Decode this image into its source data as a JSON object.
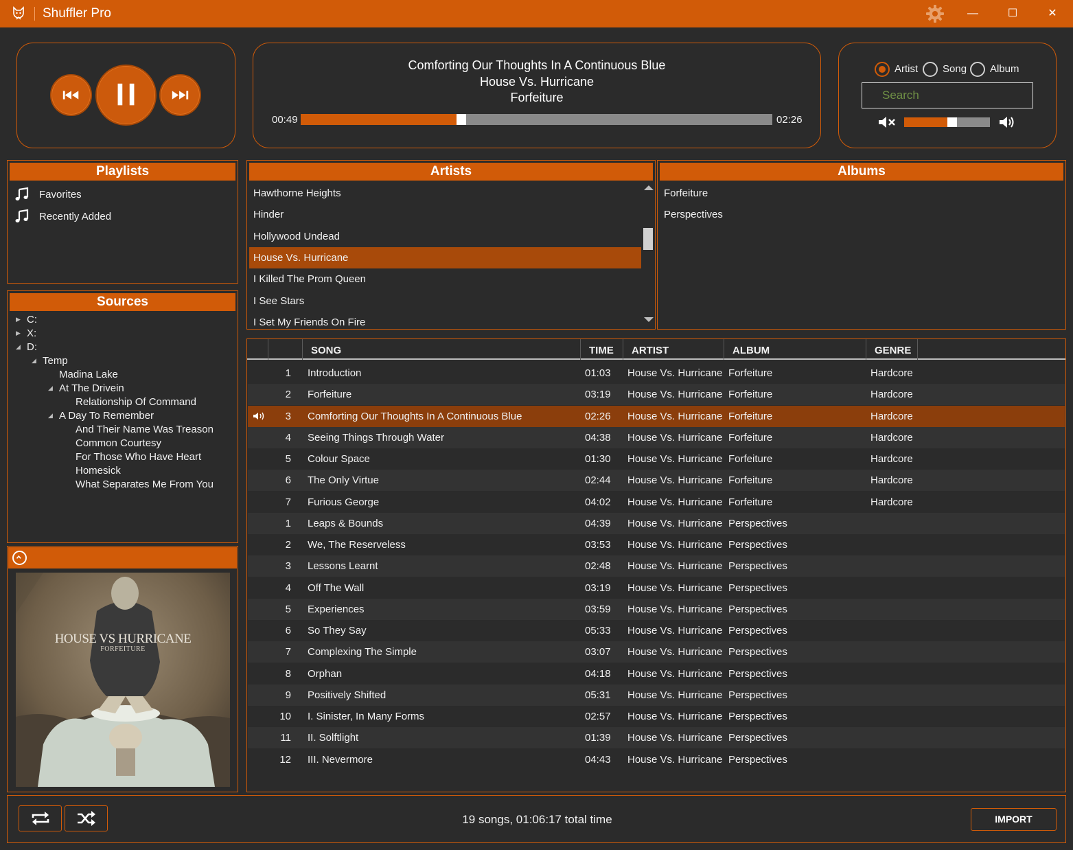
{
  "window": {
    "title": "Shuffler Pro",
    "minimize_label": "—",
    "maximize_label": "☐",
    "close_label": "✕"
  },
  "colors": {
    "accent": "#d15b08",
    "background": "#2b2b2b",
    "row_alt": "#333333",
    "selected": "#a84a0a",
    "playing_row": "#8b3e0c",
    "track": "#8a8a8a"
  },
  "now_playing": {
    "title": "Comforting Our Thoughts In A Continuous Blue",
    "artist": "House Vs. Hurricane",
    "album": "Forfeiture",
    "elapsed": "00:49",
    "total": "02:26",
    "progress": 0.34
  },
  "transport": {
    "prev_icon": "skip-previous-icon",
    "pause_icon": "pause-icon",
    "next_icon": "skip-next-icon"
  },
  "search": {
    "filters": [
      "Artist",
      "Song",
      "Album"
    ],
    "selected_filter": "Artist",
    "placeholder": "Search",
    "volume": 0.56
  },
  "playlists": {
    "header": "Playlists",
    "items": [
      "Favorites",
      "Recently Added"
    ]
  },
  "sources": {
    "header": "Sources",
    "tree": [
      {
        "label": "C:",
        "depth": 0,
        "expander": "collapsed"
      },
      {
        "label": "X:",
        "depth": 0,
        "expander": "collapsed"
      },
      {
        "label": "D:",
        "depth": 0,
        "expander": "expanded"
      },
      {
        "label": "Temp",
        "depth": 1,
        "expander": "expanded"
      },
      {
        "label": "Madina Lake",
        "depth": 2,
        "expander": "none"
      },
      {
        "label": "At The Drivein",
        "depth": 2,
        "expander": "expanded"
      },
      {
        "label": "Relationship Of Command",
        "depth": 3,
        "expander": "none"
      },
      {
        "label": "A Day To Remember",
        "depth": 2,
        "expander": "expanded"
      },
      {
        "label": "And Their Name Was Treason",
        "depth": 3,
        "expander": "none"
      },
      {
        "label": "Common Courtesy",
        "depth": 3,
        "expander": "none"
      },
      {
        "label": "For Those Who Have Heart",
        "depth": 3,
        "expander": "none"
      },
      {
        "label": "Homesick",
        "depth": 3,
        "expander": "none"
      },
      {
        "label": "What Separates Me From You",
        "depth": 3,
        "expander": "none"
      }
    ]
  },
  "album_art": {
    "band": "HOUSE VS HURRICANE",
    "album": "FORFEITURE"
  },
  "artists": {
    "header": "Artists",
    "items": [
      "Hawthorne Heights",
      "Hinder",
      "Hollywood Undead",
      "House Vs. Hurricane",
      "I Killed The Prom Queen",
      "I See Stars",
      "I Set My Friends On Fire"
    ],
    "selected": "House Vs. Hurricane"
  },
  "albums": {
    "header": "Albums",
    "items": [
      "Forfeiture",
      "Perspectives"
    ]
  },
  "songs": {
    "columns": [
      "SONG",
      "TIME",
      "ARTIST",
      "ALBUM",
      "GENRE"
    ],
    "playing_index": 2,
    "rows": [
      {
        "num": "1",
        "song": "Introduction",
        "time": "01:03",
        "artist": "House Vs. Hurricane",
        "album": "Forfeiture",
        "genre": "Hardcore"
      },
      {
        "num": "2",
        "song": "Forfeiture",
        "time": "03:19",
        "artist": "House Vs. Hurricane",
        "album": "Forfeiture",
        "genre": "Hardcore"
      },
      {
        "num": "3",
        "song": "Comforting Our Thoughts In A Continuous Blue",
        "time": "02:26",
        "artist": "House Vs. Hurricane",
        "album": "Forfeiture",
        "genre": "Hardcore"
      },
      {
        "num": "4",
        "song": "Seeing Things Through Water",
        "time": "04:38",
        "artist": "House Vs. Hurricane",
        "album": "Forfeiture",
        "genre": "Hardcore"
      },
      {
        "num": "5",
        "song": "Colour Space",
        "time": "01:30",
        "artist": "House Vs. Hurricane",
        "album": "Forfeiture",
        "genre": "Hardcore"
      },
      {
        "num": "6",
        "song": "The Only Virtue",
        "time": "02:44",
        "artist": "House Vs. Hurricane",
        "album": "Forfeiture",
        "genre": "Hardcore"
      },
      {
        "num": "7",
        "song": "Furious George",
        "time": "04:02",
        "artist": "House Vs. Hurricane",
        "album": "Forfeiture",
        "genre": "Hardcore"
      },
      {
        "num": "1",
        "song": "Leaps & Bounds",
        "time": "04:39",
        "artist": "House Vs. Hurricane",
        "album": "Perspectives",
        "genre": ""
      },
      {
        "num": "2",
        "song": "We, The Reserveless",
        "time": "03:53",
        "artist": "House Vs. Hurricane",
        "album": "Perspectives",
        "genre": ""
      },
      {
        "num": "3",
        "song": "Lessons Learnt",
        "time": "02:48",
        "artist": "House Vs. Hurricane",
        "album": "Perspectives",
        "genre": ""
      },
      {
        "num": "4",
        "song": "Off The Wall",
        "time": "03:19",
        "artist": "House Vs. Hurricane",
        "album": "Perspectives",
        "genre": ""
      },
      {
        "num": "5",
        "song": "Experiences",
        "time": "03:59",
        "artist": "House Vs. Hurricane",
        "album": "Perspectives",
        "genre": ""
      },
      {
        "num": "6",
        "song": "So They Say",
        "time": "05:33",
        "artist": "House Vs. Hurricane",
        "album": "Perspectives",
        "genre": ""
      },
      {
        "num": "7",
        "song": "Complexing The Simple",
        "time": "03:07",
        "artist": "House Vs. Hurricane",
        "album": "Perspectives",
        "genre": ""
      },
      {
        "num": "8",
        "song": "Orphan",
        "time": "04:18",
        "artist": "House Vs. Hurricane",
        "album": "Perspectives",
        "genre": ""
      },
      {
        "num": "9",
        "song": "Positively Shifted",
        "time": "05:31",
        "artist": "House Vs. Hurricane",
        "album": "Perspectives",
        "genre": ""
      },
      {
        "num": "10",
        "song": "I. Sinister, In Many Forms",
        "time": "02:57",
        "artist": "House Vs. Hurricane",
        "album": "Perspectives",
        "genre": ""
      },
      {
        "num": "11",
        "song": "II. Solftlight",
        "time": "01:39",
        "artist": "House Vs. Hurricane",
        "album": "Perspectives",
        "genre": ""
      },
      {
        "num": "12",
        "song": "III. Nevermore",
        "time": "04:43",
        "artist": "House Vs. Hurricane",
        "album": "Perspectives",
        "genre": ""
      }
    ]
  },
  "footer": {
    "summary": "19 songs, 01:06:17 total time",
    "import_label": "IMPORT",
    "repeat_icon": "repeat-icon",
    "shuffle_icon": "shuffle-icon"
  }
}
